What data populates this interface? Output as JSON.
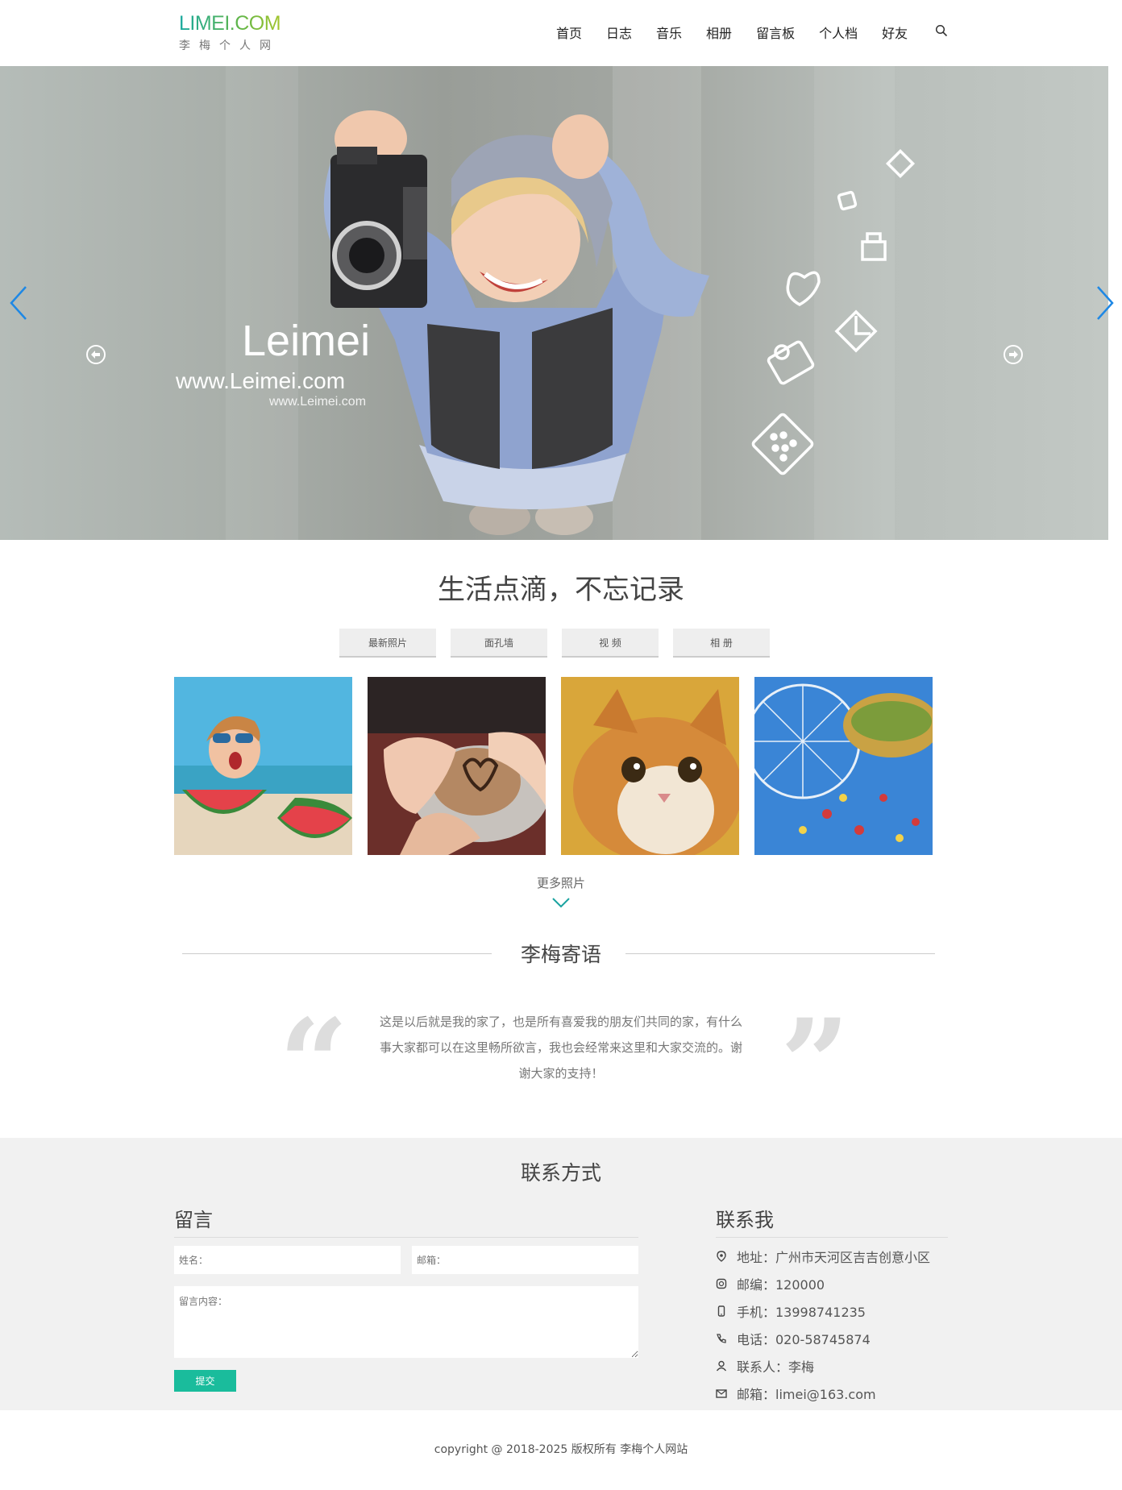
{
  "header": {
    "logo_main": "LIMEI.COM",
    "logo_sub": "李梅个人网",
    "nav": [
      "首页",
      "日志",
      "音乐",
      "相册",
      "留言板",
      "个人档",
      "好友"
    ],
    "search_icon": "search-icon"
  },
  "hero": {
    "title": "Leimei",
    "url": "www.Leimei.com",
    "url_small": "www.Leimei.com",
    "slides": 3,
    "active_slide": 1,
    "accent": "#1e88e5"
  },
  "gallery": {
    "title": "生活点滴，不忘记录",
    "tabs": [
      "最新照片",
      "面孔墙",
      "视 频",
      "相 册"
    ],
    "photos": [
      "watermelon-girl",
      "hands-coffee",
      "orange-cat",
      "ferris-wheel"
    ],
    "more": "更多照片"
  },
  "quote": {
    "title": "李梅寄语",
    "text": "这是以后就是我的家了，也是所有喜爱我的朋友们共同的家，有什么事大家都可以在这里畅所欲言，我也会经常来这里和大家交流的。谢谢大家的支持！",
    "open_mark": "“",
    "close_mark": "”"
  },
  "contact": {
    "title": "联系方式",
    "message_heading": "留言",
    "name_placeholder": "姓名：",
    "email_placeholder": "邮箱：",
    "content_placeholder": "留言内容：",
    "submit": "提交",
    "submit_color": "#1abc9c",
    "me_heading": "联系我",
    "items": [
      {
        "icon": "location-icon",
        "text": "地址：广州市天河区吉吉创意小区"
      },
      {
        "icon": "postcode-icon",
        "text": "邮编：120000"
      },
      {
        "icon": "mobile-icon",
        "text": "手机：13998741235"
      },
      {
        "icon": "phone-icon",
        "text": "电话：020-58745874"
      },
      {
        "icon": "person-icon",
        "text": "联系人：李梅"
      },
      {
        "icon": "mail-icon",
        "text": "邮箱：limei@163.com"
      }
    ]
  },
  "footer": {
    "copyright": "copyright @ 2018-2025 版权所有 李梅个人网站"
  }
}
